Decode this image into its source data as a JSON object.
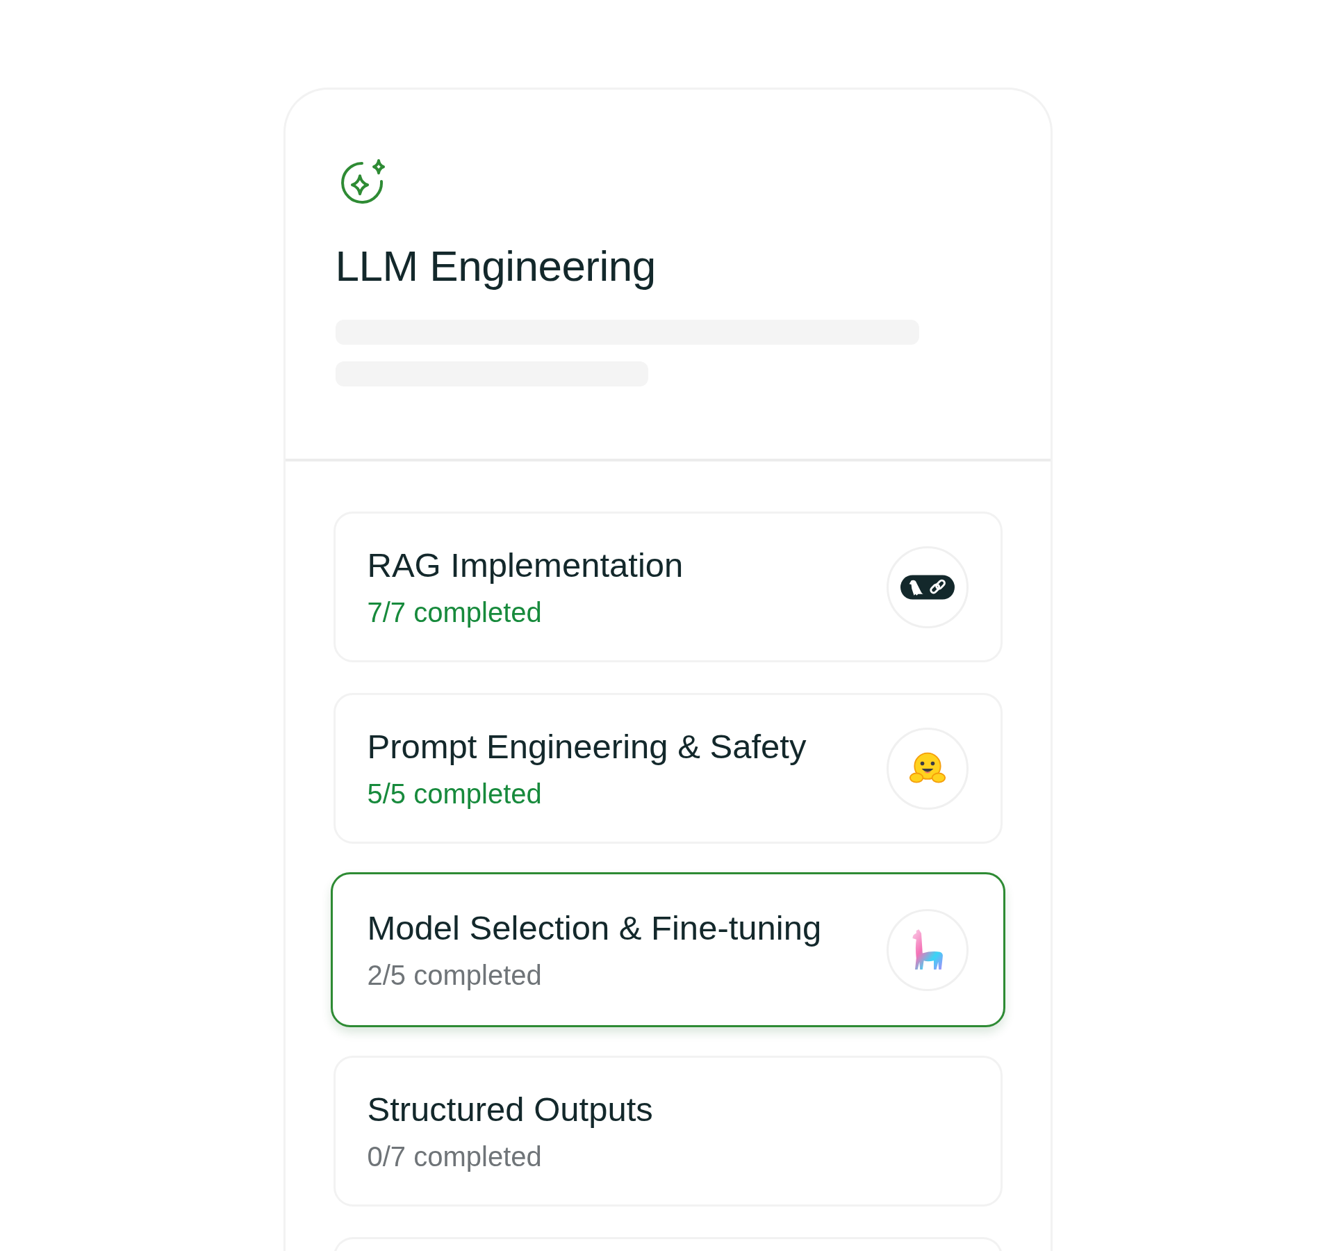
{
  "course": {
    "title": "LLM Engineering"
  },
  "modules": [
    {
      "title": "RAG Implementation",
      "progress": "7/7 completed",
      "complete": true,
      "selected": false,
      "kind": "parrot-link"
    },
    {
      "title": "Prompt Engineering & Safety",
      "progress": "5/5 completed",
      "complete": true,
      "selected": false,
      "kind": "hugging-face"
    },
    {
      "title": "Model Selection & Fine-tuning",
      "progress": "2/5 completed",
      "complete": false,
      "selected": true,
      "kind": "llama"
    },
    {
      "title": "Structured Outputs",
      "progress": "0/7 completed",
      "complete": false,
      "selected": false,
      "kind": "plain"
    }
  ]
}
